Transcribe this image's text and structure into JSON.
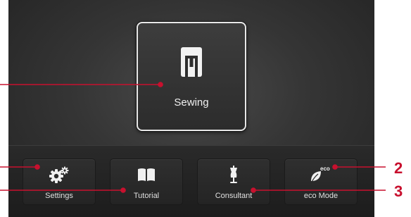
{
  "main": {
    "sewing_label": "Sewing",
    "sewing_icon": "presser-foot-icon"
  },
  "bottom_bar": {
    "buttons": [
      {
        "label": "Settings",
        "icon": "gears-icon"
      },
      {
        "label": "Tutorial",
        "icon": "book-icon"
      },
      {
        "label": "Consultant",
        "icon": "dress-form-icon"
      },
      {
        "label": "eco Mode",
        "icon": "eco-leaf-icon",
        "icon_text": "eco"
      }
    ]
  },
  "callouts": {
    "numbers": [
      "2",
      "3"
    ],
    "color": "#c8102e"
  },
  "colors": {
    "background": "#353535",
    "tile_border": "#e8e8e8",
    "text": "#f0f0f0"
  }
}
